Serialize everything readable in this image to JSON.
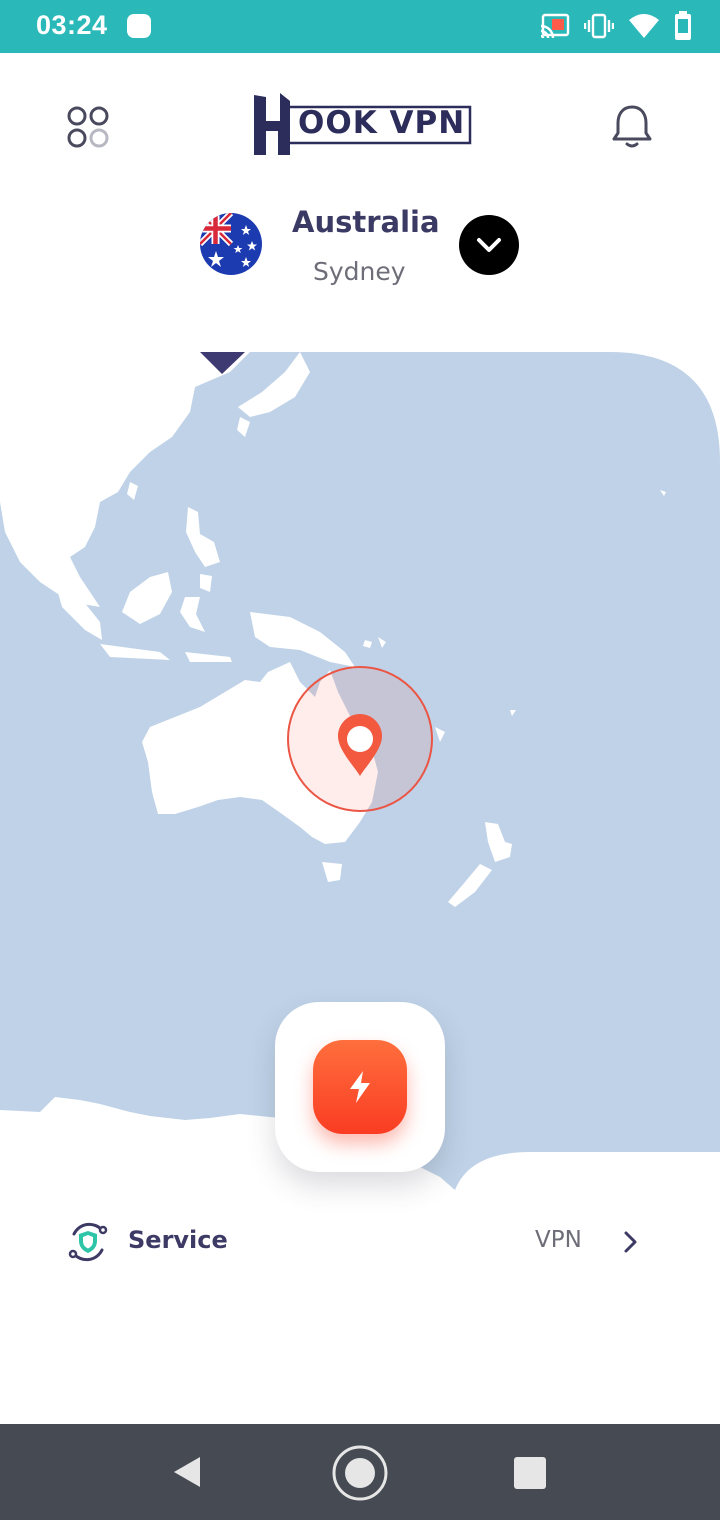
{
  "status_bar": {
    "time": "03:24"
  },
  "header": {
    "logo_text": "OOK VPN",
    "icons": [
      "apps-icon",
      "bell-icon"
    ]
  },
  "location": {
    "country": "Australia",
    "city": "Sydney"
  },
  "service": {
    "label": "Service",
    "value": "VPN"
  },
  "colors": {
    "status_bar": "#2bb8b8",
    "accent": "#fa3c23",
    "map_water": "#bfd2e7",
    "text_primary": "#3b3a64",
    "nav_bar": "#464b53"
  }
}
